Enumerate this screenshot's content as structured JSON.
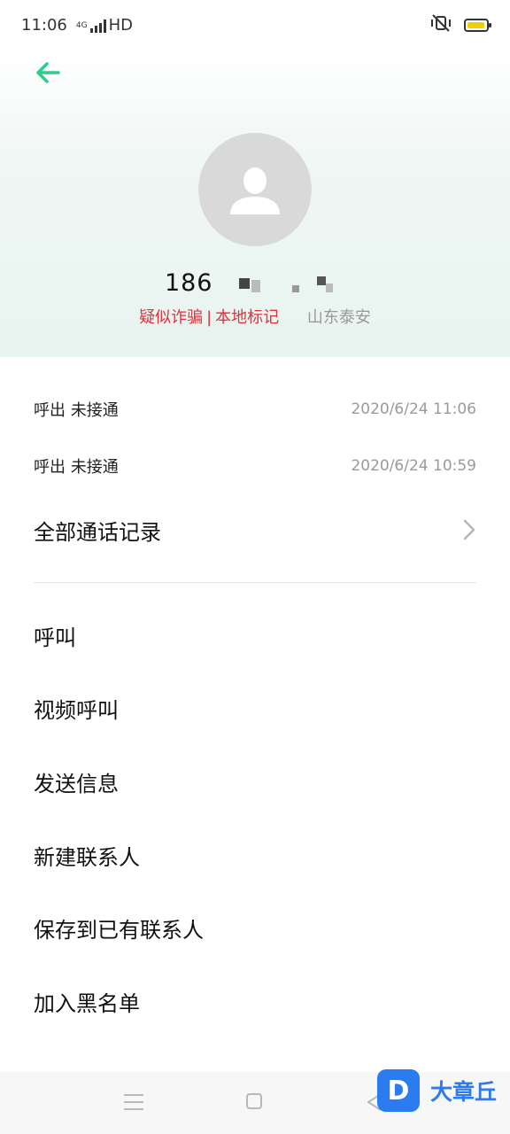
{
  "status_bar": {
    "time": "11:06",
    "network": "4G",
    "hd": "HD",
    "icons": [
      "signal-icon",
      "vibrate-off-icon",
      "battery-icon"
    ],
    "battery_color": "#f4cf00"
  },
  "header": {
    "back_icon": "back-arrow-icon",
    "accent_color": "#2ecc8b",
    "phone_number": "186 ",
    "tag_fraud": "疑似诈骗",
    "tag_separator": "|",
    "tag_local": "本地标记",
    "location": "山东泰安",
    "tag_color": "#e0313d"
  },
  "call_log": [
    {
      "type": "呼出 未接通",
      "time": "2020/6/24 11:06"
    },
    {
      "type": "呼出 未接通",
      "time": "2020/6/24 10:59"
    }
  ],
  "all_calls_label": "全部通话记录",
  "actions": [
    "呼叫",
    "视频呼叫",
    "发送信息",
    "新建联系人",
    "保存到已有联系人",
    "加入黑名单"
  ],
  "watermark": {
    "logo_letter": "D",
    "text": "大章丘"
  }
}
